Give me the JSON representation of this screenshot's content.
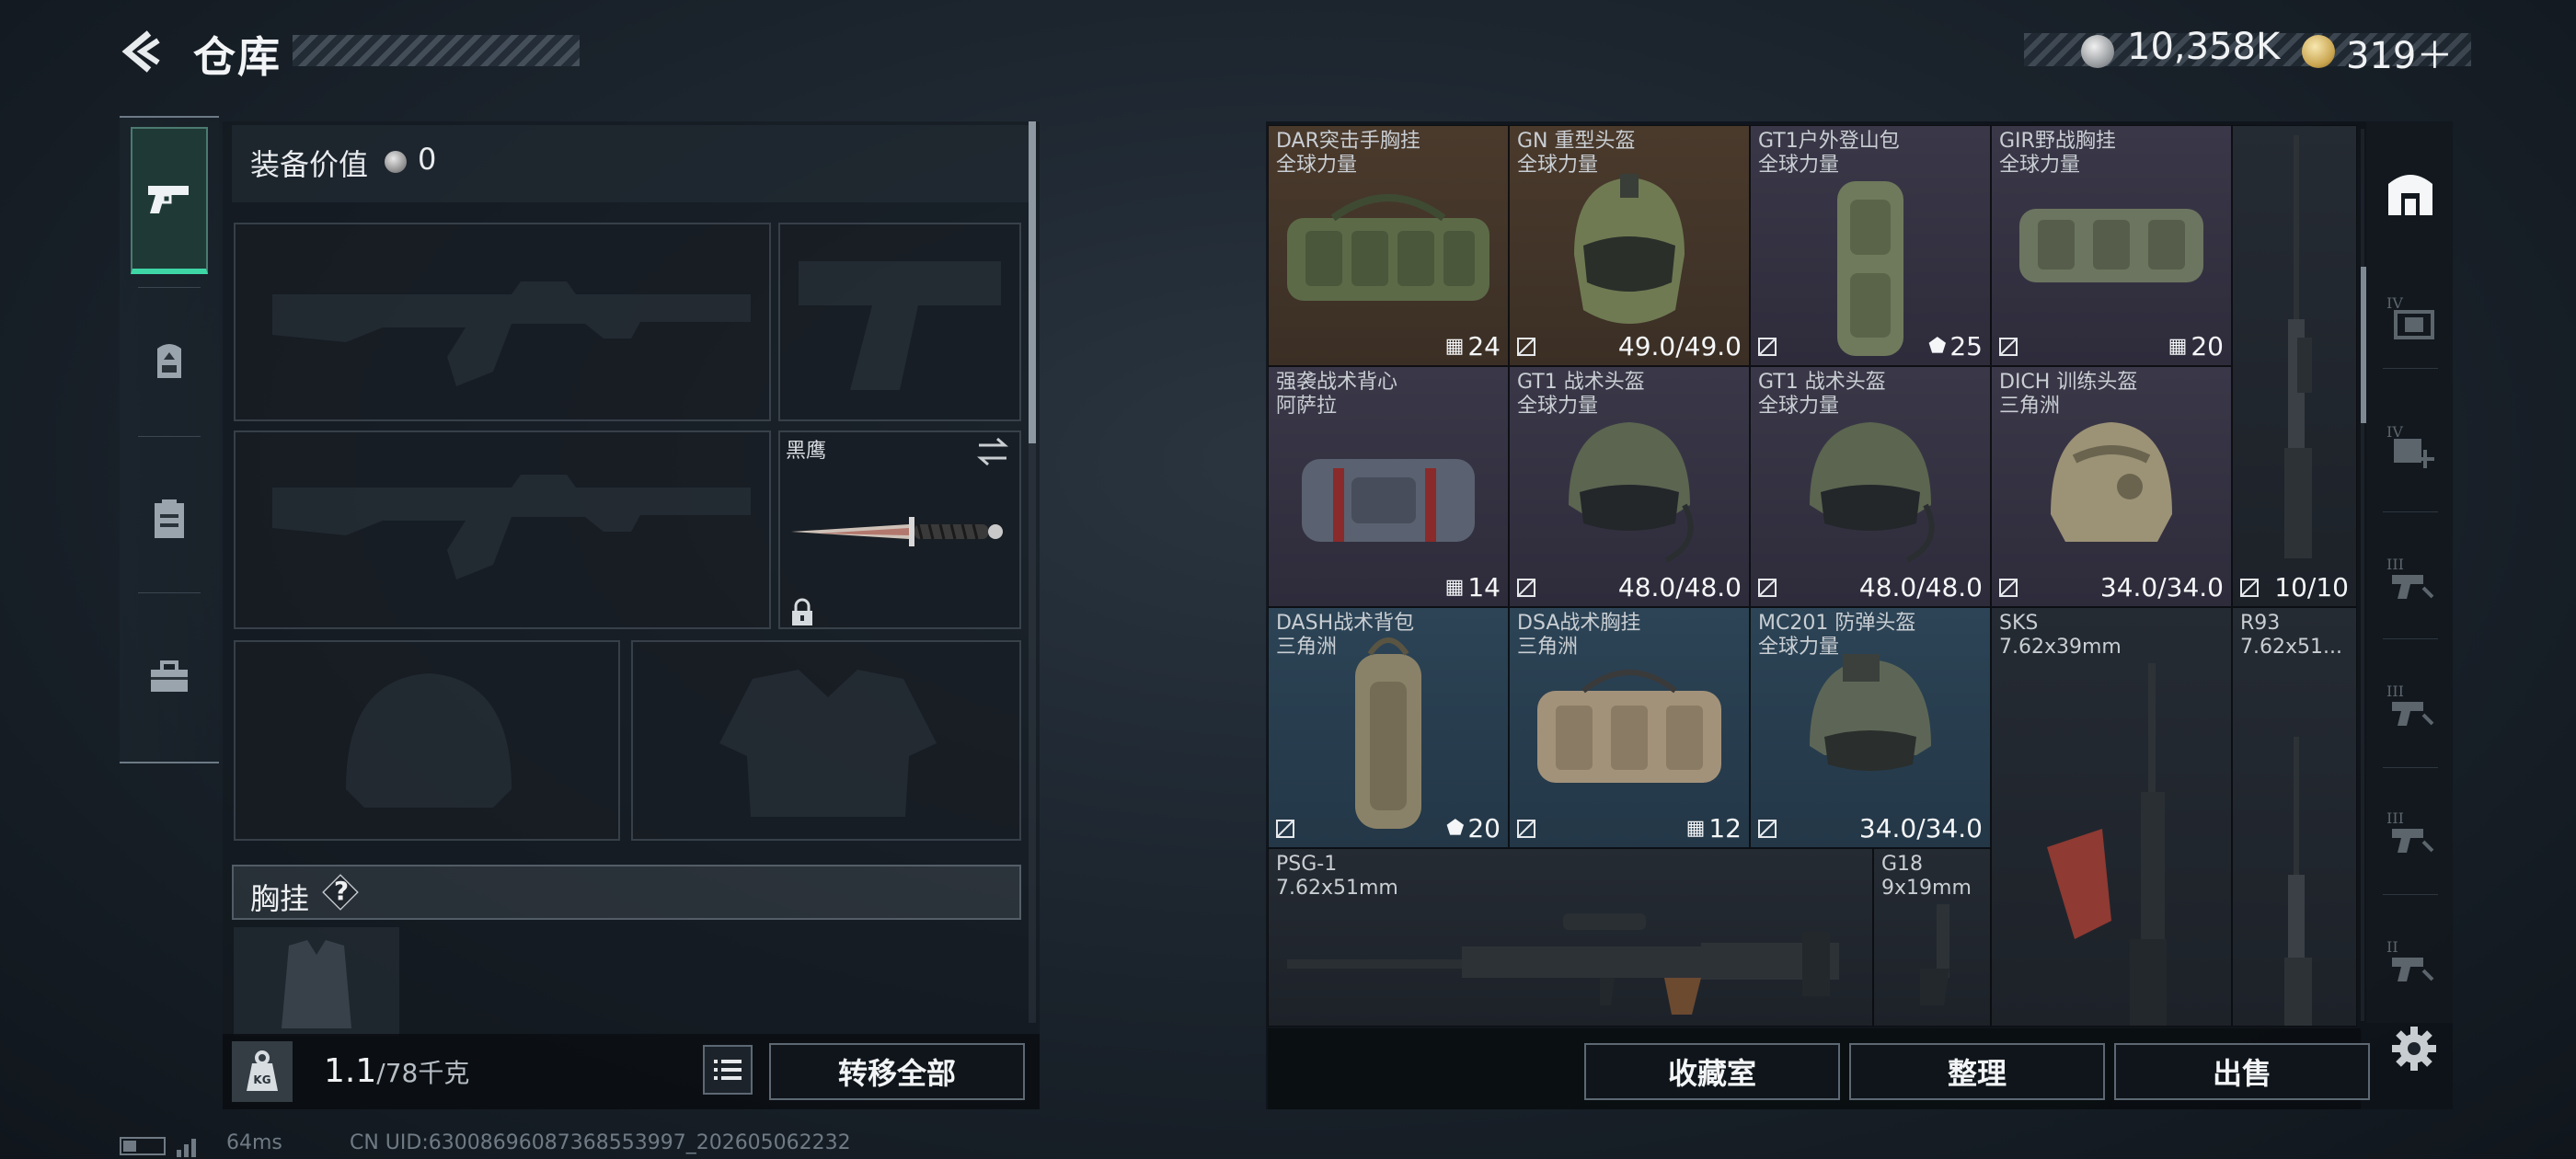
{
  "header": {
    "title": "仓库",
    "currency": [
      {
        "icon": "silver-coin-icon",
        "value": "10,358K"
      },
      {
        "icon": "gold-coin-icon",
        "value": "319＋"
      }
    ]
  },
  "left_tabs": [
    {
      "icon": "pistol-icon",
      "active": true
    },
    {
      "icon": "backpack-icon",
      "active": false
    },
    {
      "icon": "clipboard-icon",
      "active": false
    },
    {
      "icon": "toolbox-icon",
      "active": false
    }
  ],
  "equipment": {
    "value_label": "装备价值",
    "value": "0",
    "melee_name": "黑鹰",
    "chest_label": "胸挂",
    "help": "?"
  },
  "footer_left": {
    "weight": "1.1",
    "capacity": "/78千克",
    "transfer_all": "转移全部"
  },
  "storage": {
    "items": [
      {
        "name": "DAR突击手胸挂",
        "sub": "全球力量",
        "cap": "24",
        "cap_icon": "vest-icon",
        "bg": "#4a3a2c"
      },
      {
        "name": "GN 重型头盔",
        "sub": "全球力量",
        "durability": "49.0/49.0",
        "bg": "#4a3a2c"
      },
      {
        "name": "GT1户外登山包",
        "sub": "全球力量",
        "cap": "25",
        "cap_icon": "backpack-icon",
        "bg": "#3a3848"
      },
      {
        "name": "GIR野战胸挂",
        "sub": "全球力量",
        "cap": "20",
        "cap_icon": "vest-icon",
        "bg": "#3a3848"
      },
      {
        "name": "强袭战术背心",
        "sub": "阿萨拉",
        "cap": "14",
        "cap_icon": "vest-icon",
        "bg": "#3a3848"
      },
      {
        "name": "GT1 战术头盔",
        "sub": "全球力量",
        "durability": "48.0/48.0",
        "bg": "#3a3848"
      },
      {
        "name": "GT1 战术头盔",
        "sub": "全球力量",
        "durability": "48.0/48.0",
        "bg": "#3a3848"
      },
      {
        "name": "DICH 训练头盔",
        "sub": "三角洲",
        "durability": "34.0/34.0",
        "bg": "#3a3848"
      },
      {
        "name": "",
        "sub": "",
        "durability": "10/10",
        "bg": "#252b33"
      },
      {
        "name": "DASH战术背包",
        "sub": "三角洲",
        "cap": "20",
        "cap_icon": "backpack-icon",
        "bg": "#2c4456"
      },
      {
        "name": "DSA战术胸挂",
        "sub": "三角洲",
        "cap": "12",
        "cap_icon": "vest-icon",
        "bg": "#2c4456"
      },
      {
        "name": "MC201 防弹头盔",
        "sub": "全球力量",
        "durability": "34.0/34.0",
        "bg": "#2c4456"
      },
      {
        "name": "SKS",
        "sub": "7.62x39mm",
        "bg": "#252b33"
      },
      {
        "name": "R93",
        "sub": "7.62x51...",
        "bg": "#252b33"
      },
      {
        "name": "PSG-1",
        "sub": "7.62x51mm",
        "bg": "#252b33"
      },
      {
        "name": "G18",
        "sub": "9x19mm",
        "bg": "#252b33"
      }
    ]
  },
  "footer_right": {
    "vault": "收藏室",
    "sort": "整理",
    "sell": "出售"
  },
  "right_tabs": [
    {
      "icon": "category-all-icon",
      "active": true
    },
    {
      "icon": "armor-iv-icon",
      "label": "IV"
    },
    {
      "icon": "medkit-iv-icon",
      "label": "IV"
    },
    {
      "icon": "weapon-iii-icon",
      "label": "III"
    },
    {
      "icon": "weapon-iii-icon",
      "label": "III"
    },
    {
      "icon": "weapon-iii-icon",
      "label": "III"
    },
    {
      "icon": "weapon-ii-icon",
      "label": "II"
    }
  ],
  "status": {
    "ping": "64ms",
    "uid": "CN UID:63008696087368553997_202605062232"
  },
  "colors": {
    "accent": "#3fd6a6",
    "rarity_brown": "#4a3a2c",
    "rarity_purple": "#3a3848",
    "rarity_blue": "#2c4456"
  }
}
